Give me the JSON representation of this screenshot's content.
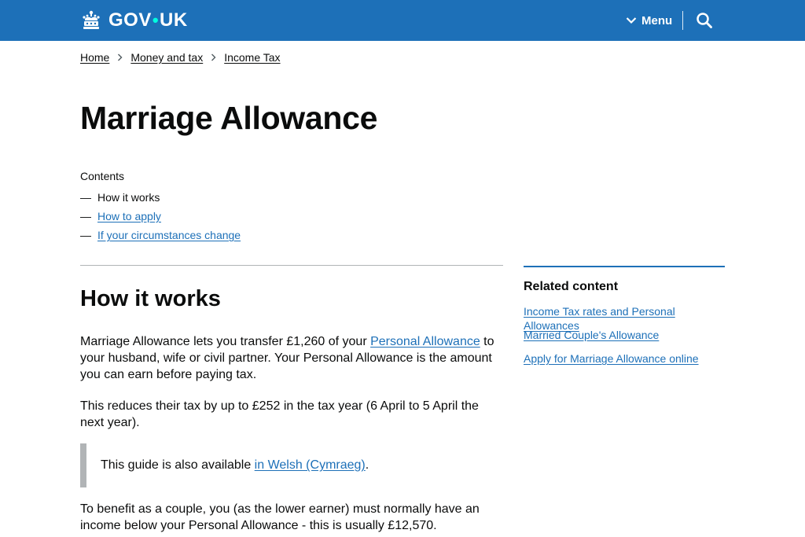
{
  "header": {
    "logo_text_left": "GOV",
    "logo_dot": "•",
    "logo_text_right": "UK",
    "menu_label": "Menu",
    "brand_color": "#1d70b8",
    "icons": [
      "crown-icon",
      "chevron-down-icon",
      "search-icon"
    ]
  },
  "breadcrumb": [
    {
      "label": "Home"
    },
    {
      "label": "Money and tax"
    },
    {
      "label": "Income Tax"
    }
  ],
  "page": {
    "title": "Marriage Allowance"
  },
  "contents": {
    "title": "Contents",
    "dash": "—",
    "items": [
      {
        "label": "How it works",
        "current": true
      },
      {
        "label": "How to apply",
        "current": false
      },
      {
        "label": "If your circumstances change",
        "current": false
      }
    ]
  },
  "section": {
    "heading": "How it works",
    "p1_before": "Marriage Allowance lets you transfer £1,260 of your ",
    "p1_link": "Personal Allowance",
    "p1_after": " to your husband, wife or civil partner. Your Personal Allowance is the amount you can earn before paying tax.",
    "p2": "This reduces their tax by up to £252 in the tax year (6 April to 5 April the next year).",
    "inset_before": "This guide is also available ",
    "inset_link": "in Welsh (Cymraeg)",
    "inset_after": ".",
    "p3": "To benefit as a couple, you (as the lower earner) must normally have an income below your Personal Allowance - this is usually £12,570."
  },
  "related": {
    "title": "Related content",
    "links": [
      {
        "label": "Income Tax rates and Personal Allowances"
      },
      {
        "label": "Married Couple's Allowance"
      },
      {
        "label": "Apply for Marriage Allowance online"
      }
    ],
    "accent_color": "#1d70b8"
  },
  "colors": {
    "link": "#1d70b8",
    "text": "#0b0c0c",
    "border": "#b1b4b6",
    "logo_dot": "#00ffe0"
  }
}
